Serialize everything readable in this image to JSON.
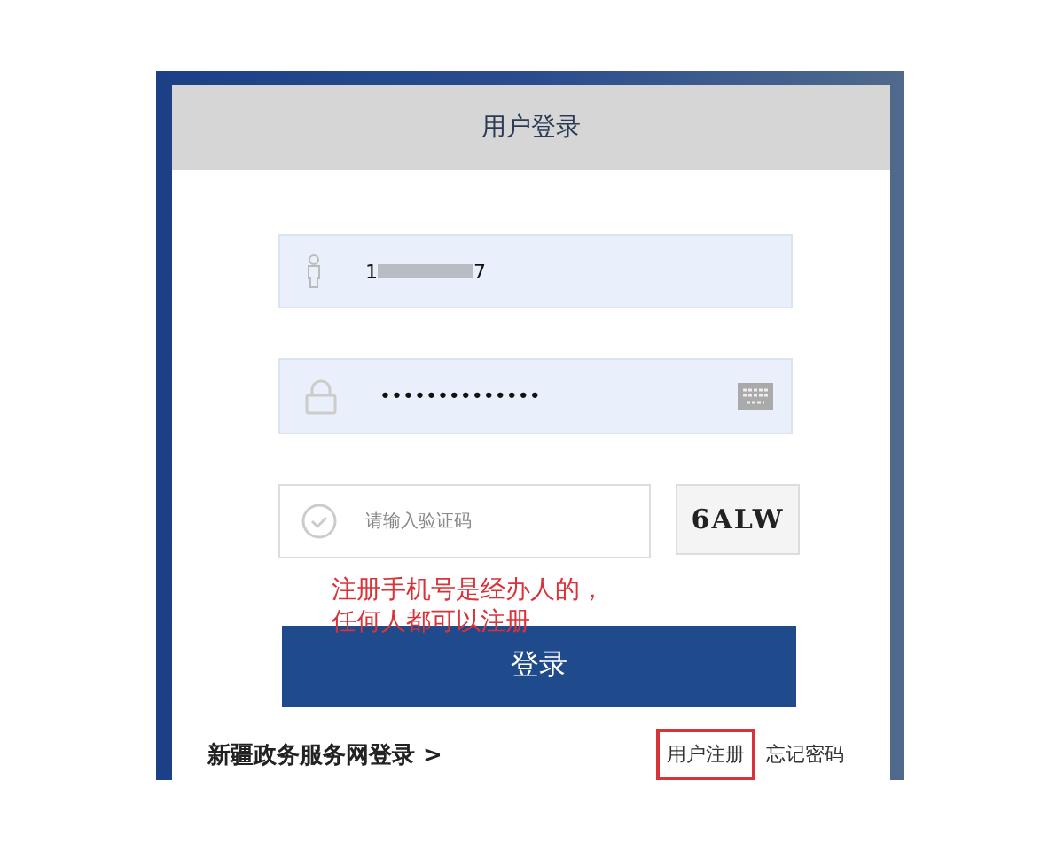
{
  "login_card": {
    "title": "用户登录",
    "username": {
      "value_start": "1",
      "value_end": "7"
    },
    "password": {
      "value": "••••••••••••••"
    },
    "captcha": {
      "placeholder": "请输入验证码",
      "image_text": "6ALW"
    },
    "annotation": [
      "注册手机号是经办人的，",
      "任何人都可以注册"
    ],
    "login_button": "登录",
    "portal_link": "新疆政务服务网登录 >",
    "links": [
      {
        "label": "用户注册",
        "highlighted": true
      },
      {
        "label": "忘记密码",
        "highlighted": false
      }
    ]
  }
}
